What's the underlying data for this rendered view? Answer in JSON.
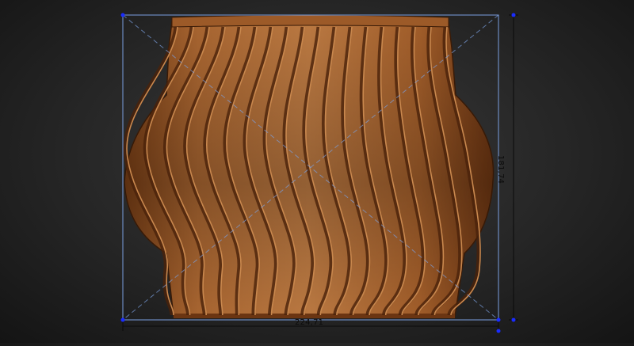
{
  "dimensions": {
    "width": "224,71",
    "height": "181,74"
  },
  "colors": {
    "background": "#262626",
    "wood_light": "#b8743c",
    "wood_dark": "#6e3a16",
    "bounding_box": "#7a9fe0",
    "handle": "#1a2cff",
    "dimension_line": "#0a0a0a"
  },
  "object": {
    "name": "wooden-slatted-vase",
    "slat_count": 18
  }
}
